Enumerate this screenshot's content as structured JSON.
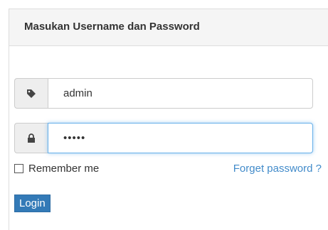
{
  "panel": {
    "title": "Masukan Username dan Password"
  },
  "form": {
    "username": {
      "value": "admin",
      "icon": "tag-icon"
    },
    "password": {
      "masked_value": "•••••",
      "icon": "lock-icon"
    },
    "remember_label": "Remember me",
    "remember_checked": false,
    "forget_label": "Forget password ?",
    "login_label": "Login"
  },
  "colors": {
    "accent": "#337ab7",
    "link": "#428bca",
    "focus_border": "#66afe9"
  }
}
